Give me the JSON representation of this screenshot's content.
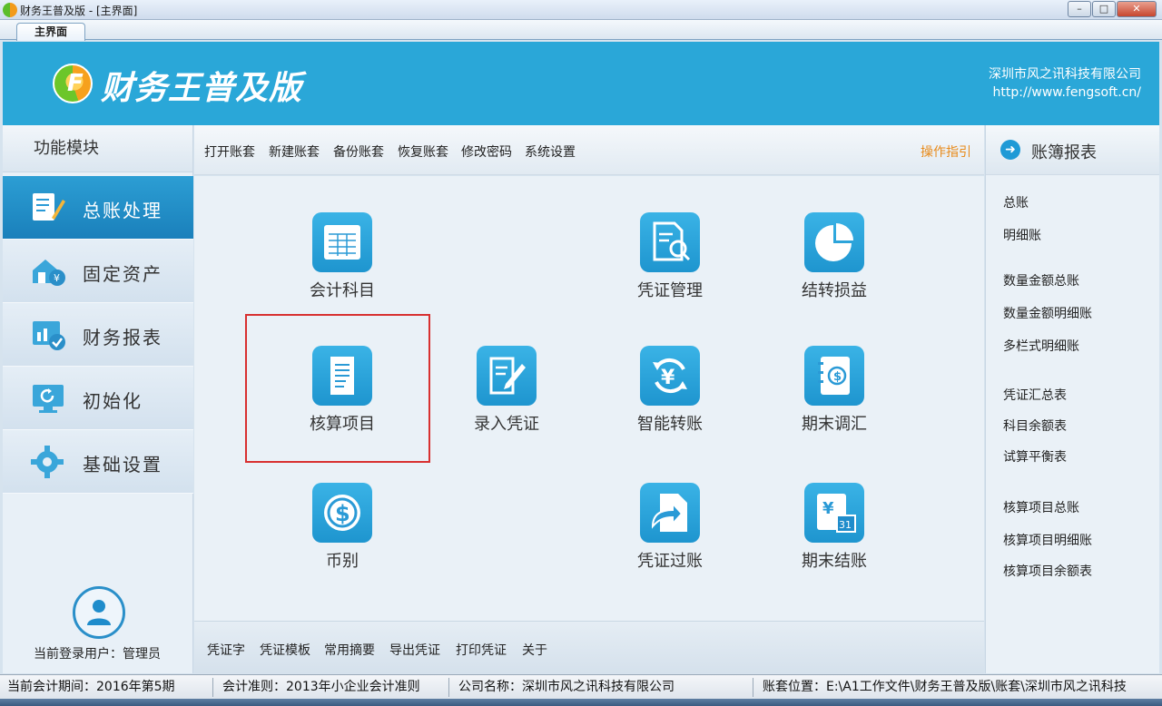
{
  "window": {
    "title": "财务王普及版 - [主界面]",
    "min": "–",
    "max": "□",
    "close": "✕"
  },
  "tabs": [
    {
      "label": "主界面"
    }
  ],
  "header": {
    "app_name": "财务王普及版",
    "logo_letter": "F",
    "company": "深圳市风之讯科技有限公司",
    "url": "http://www.fengsoft.cn/"
  },
  "sidebar": {
    "title": "功能模块",
    "items": [
      {
        "label": "总账处理",
        "icon": "ledger-pen-icon",
        "active": true
      },
      {
        "label": "固定资产",
        "icon": "house-yen-icon"
      },
      {
        "label": "财务报表",
        "icon": "report-check-icon"
      },
      {
        "label": "初始化",
        "icon": "monitor-refresh-icon"
      },
      {
        "label": "基础设置",
        "icon": "gear-icon"
      }
    ],
    "user_label": "当前登录用户：管理员"
  },
  "toolbar": {
    "items": [
      "打开账套",
      "新建账套",
      "备份账套",
      "恢复账套",
      "修改密码",
      "系统设置"
    ],
    "guide": "操作指引"
  },
  "tiles": [
    {
      "label": "会计科目",
      "icon": "table-icon"
    },
    {
      "label": "凭证管理",
      "icon": "document-search-icon"
    },
    {
      "label": "结转损益",
      "icon": "pie-chart-icon"
    },
    {
      "label": "核算项目",
      "icon": "notepad-icon"
    },
    {
      "label": "录入凭证",
      "icon": "document-edit-icon"
    },
    {
      "label": "智能转账",
      "icon": "yen-cycle-icon"
    },
    {
      "label": "期末调汇",
      "icon": "dollar-notebook-icon"
    },
    {
      "label": "币别",
      "icon": "dollar-coin-icon"
    },
    {
      "label": "凭证过账",
      "icon": "document-arrow-icon"
    },
    {
      "label": "期末结账",
      "icon": "calendar-yen-icon"
    }
  ],
  "bottom_toolbar": {
    "items": [
      "凭证字",
      "凭证模板",
      "常用摘要",
      "导出凭证",
      "打印凭证",
      "关于"
    ]
  },
  "reports": {
    "title": "账簿报表",
    "links": [
      "总账",
      "明细账",
      "数量金额总账",
      "数量金额明细账",
      "多栏式明细账",
      "凭证汇总表",
      "科目余额表",
      "试算平衡表",
      "核算项目总账",
      "核算项目明细账",
      "核算项目余额表"
    ]
  },
  "status": {
    "period": "当前会计期间：2016年第5期",
    "standard": "会计准则：2013年小企业会计准则",
    "company": "公司名称：深圳市风之讯科技有限公司",
    "location": "账套位置：E:\\A1工作文件\\财务王普及版\\账套\\深圳市风之讯科技"
  },
  "colors": {
    "header_blue": "#2aa7d8",
    "active_nav": "#1a80bb",
    "guide_orange": "#e88a1a",
    "highlight_red": "#d83030"
  }
}
